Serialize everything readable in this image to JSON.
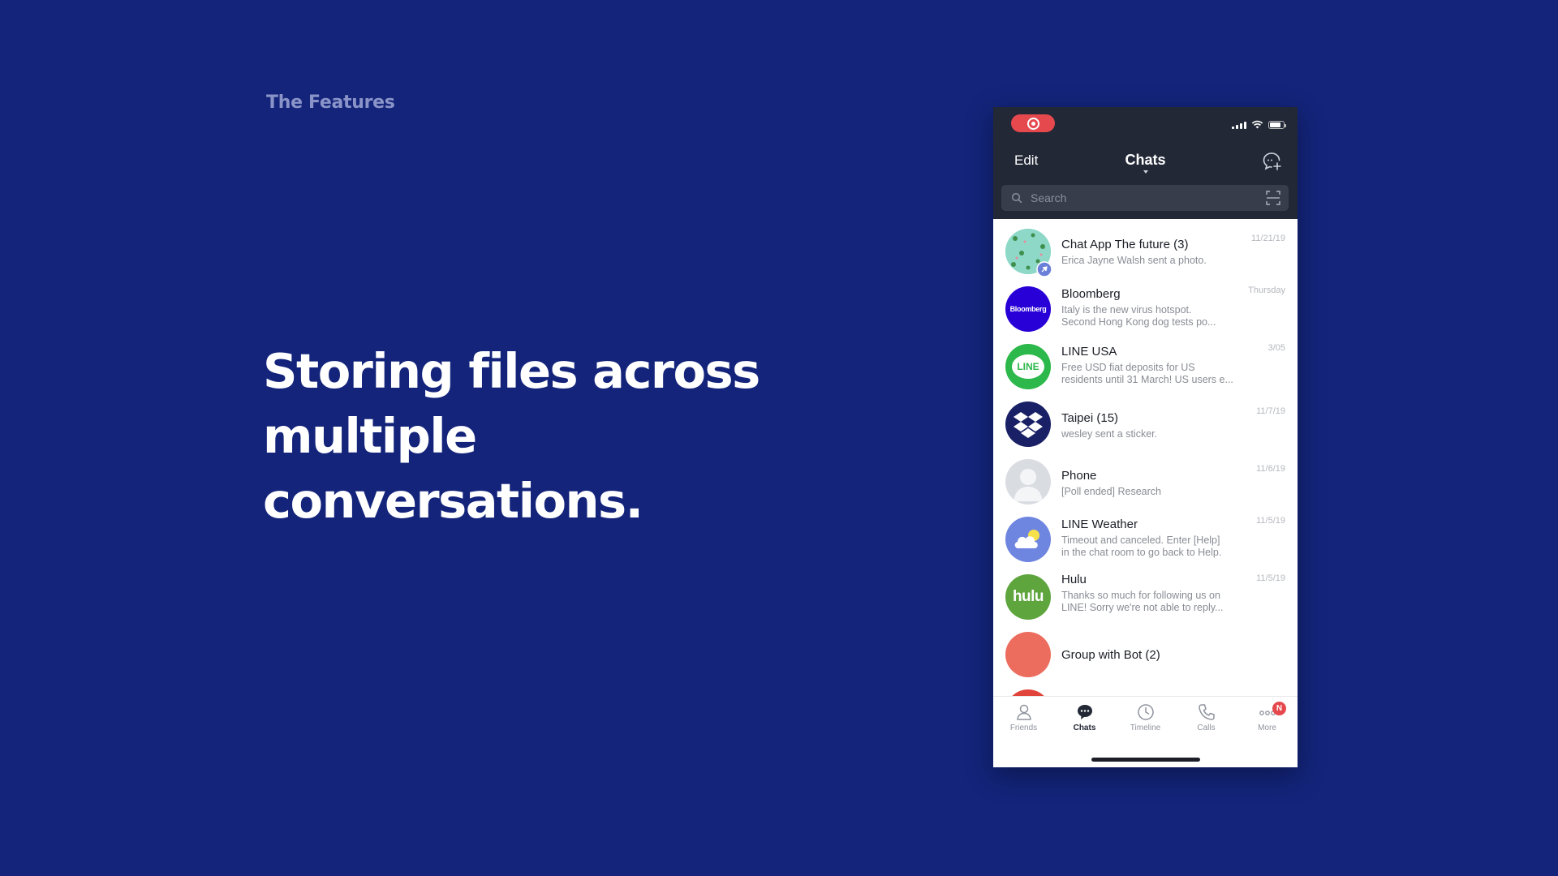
{
  "slide": {
    "eyebrow": "The Features",
    "headline": "Storing files across multiple conversations."
  },
  "colors": {
    "background": "#13247a",
    "phone_header": "#222836",
    "record_pill": "#e5484d"
  },
  "phone": {
    "nav": {
      "edit_label": "Edit",
      "title": "Chats",
      "compose_icon": "new-chat-icon"
    },
    "search": {
      "placeholder": "Search",
      "scan_icon": "scan-icon"
    },
    "chats": [
      {
        "title": "Chat App The future  (3)",
        "lines": [
          "Erica Jayne Walsh sent a photo."
        ],
        "date": "11/21/19",
        "avatar": "pattern-avatar",
        "pinned": true
      },
      {
        "title": "Bloomberg",
        "lines": [
          "Italy is the new virus hotspot.",
          "Second Hong Kong dog tests po..."
        ],
        "date": "Thursday",
        "avatar_text": "Bloomberg"
      },
      {
        "title": "LINE USA",
        "lines": [
          "Free USD fiat deposits for US",
          "residents until 31 March!  US users e..."
        ],
        "date": "3/05",
        "avatar_text": "LINE"
      },
      {
        "title": "Taipei  (15)",
        "lines": [
          "wesley sent a sticker."
        ],
        "date": "11/7/19",
        "avatar": "dropbox-logo"
      },
      {
        "title": "Phone",
        "lines": [
          "[Poll ended] Research"
        ],
        "date": "11/6/19",
        "avatar": "default-person"
      },
      {
        "title": "LINE Weather",
        "lines": [
          "Timeout and canceled. Enter [Help]",
          "in the chat room to go back to Help."
        ],
        "date": "11/5/19",
        "avatar": "weather-cloud"
      },
      {
        "title": "Hulu",
        "lines": [
          "Thanks so much for following us on",
          "LINE! Sorry we're not able to reply..."
        ],
        "date": "11/5/19",
        "avatar_text": "hulu"
      },
      {
        "title": "Group with Bot  (2)",
        "lines": [],
        "date": "",
        "avatar": "coral-circle"
      }
    ],
    "tabs": [
      {
        "label": "Friends",
        "icon": "person-icon"
      },
      {
        "label": "Chats",
        "icon": "chat-bubble-icon",
        "active": true
      },
      {
        "label": "Timeline",
        "icon": "clock-icon"
      },
      {
        "label": "Calls",
        "icon": "phone-icon"
      },
      {
        "label": "More",
        "icon": "more-dots-icon",
        "badge": "N"
      }
    ]
  }
}
